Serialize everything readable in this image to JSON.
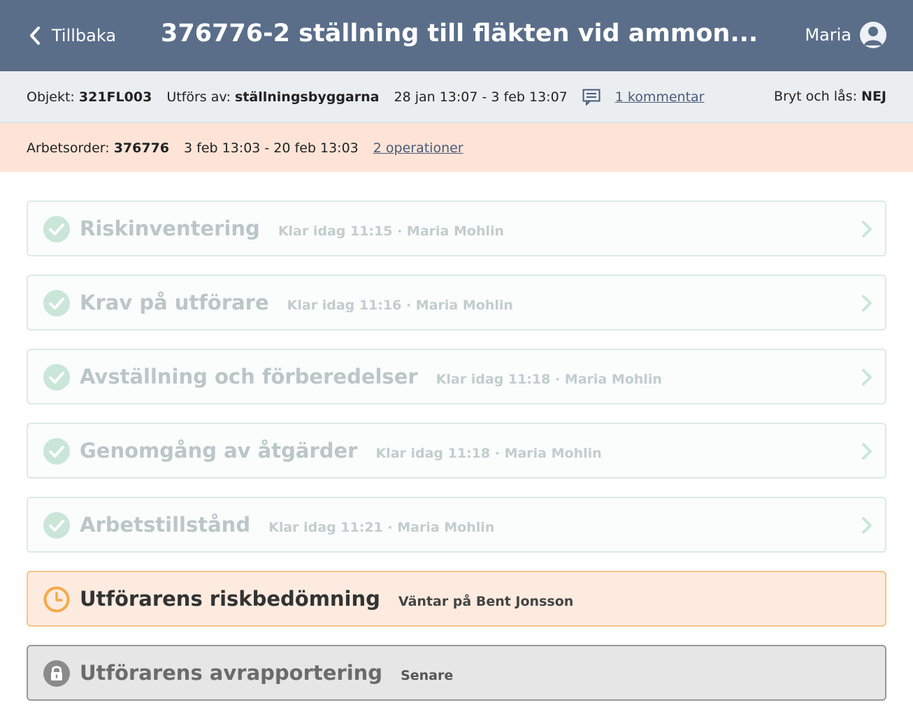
{
  "header": {
    "back_label": "Tillbaka",
    "title": "376776-2 ställning till fläkten vid ammon...",
    "user_name": "Maria"
  },
  "info": {
    "object_label": "Objekt:",
    "object_value": "321FL003",
    "performed_by_label": "Utförs av:",
    "performed_by_value": "ställningsbyggarna",
    "period": "28 jan 13:07 - 3 feb 13:07",
    "comments_link": "1 kommentar",
    "lock_label": "Bryt och lås:",
    "lock_value": "NEJ"
  },
  "order": {
    "label": "Arbetsorder:",
    "value": "376776",
    "period": "3 feb 13:03 - 20 feb 13:03",
    "operations_link": "2 operationer"
  },
  "steps": [
    {
      "title": "Riskinventering",
      "status": "Klar idag 11:15 · Maria Mohlin",
      "state": "done"
    },
    {
      "title": "Krav på utförare",
      "status": "Klar idag 11:16 · Maria Mohlin",
      "state": "done"
    },
    {
      "title": "Avställning och förberedelser",
      "status": "Klar idag 11:18 · Maria Mohlin",
      "state": "done"
    },
    {
      "title": "Genomgång av åtgärder",
      "status": "Klar idag 11:18 · Maria Mohlin",
      "state": "done"
    },
    {
      "title": "Arbetstillstånd",
      "status": "Klar idag 11:21 · Maria Mohlin",
      "state": "done"
    },
    {
      "title": "Utförarens riskbedömning",
      "status": "Väntar på Bent Jonsson",
      "state": "pending"
    },
    {
      "title": "Utförarens avrapportering",
      "status": "Senare",
      "state": "locked"
    }
  ],
  "icons": {
    "back": "chevron-left-icon",
    "user": "user-avatar-icon",
    "comment": "comment-icon",
    "done": "check-circle-icon",
    "pending": "clock-icon",
    "locked": "lock-icon",
    "open": "chevron-right-icon"
  },
  "colors": {
    "header_bg": "#5a6e8a",
    "info_bg": "#eaeef1",
    "order_bg": "#fde4d7",
    "done": "#c9e6d9",
    "pending": "#f5a94a",
    "locked": "#8a8a8a"
  }
}
